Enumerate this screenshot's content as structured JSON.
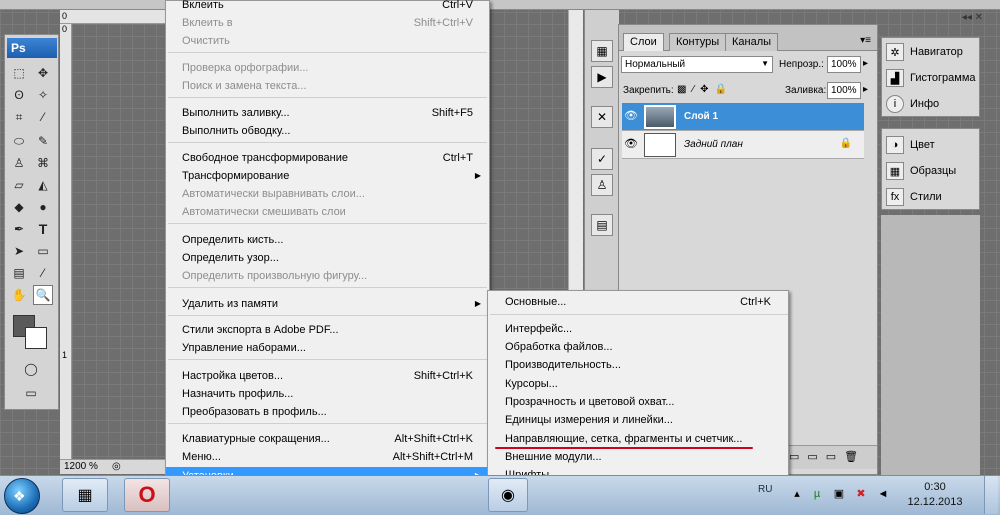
{
  "ruler": {
    "top_num": "0",
    "left_num_top": "0",
    "left_num_mid": "1"
  },
  "status": {
    "zoom": "1200 %"
  },
  "tools": {
    "logo": "Ps"
  },
  "layers_panel": {
    "tabs": [
      "Слои",
      "Контуры",
      "Каналы"
    ],
    "blend_mode": "Нормальный",
    "opacity_label": "Непрозр.:",
    "opacity_value": "100%",
    "lock_label": "Закрепить:",
    "fill_label": "Заливка:",
    "fill_value": "100%",
    "layers": [
      {
        "name": "Слой 1",
        "selected": true
      },
      {
        "name": "Задний план",
        "selected": false
      }
    ]
  },
  "right_panels": {
    "group1": [
      "Навигатор",
      "Гистограмма",
      "Инфо"
    ],
    "group2": [
      "Цвет",
      "Образцы",
      "Стили"
    ]
  },
  "edit_menu": {
    "items": [
      {
        "label": "Вклеить",
        "shortcut": "Ctrl+V",
        "disabled": false
      },
      {
        "label": "Вклеить в",
        "shortcut": "Shift+Ctrl+V",
        "disabled": true
      },
      {
        "label": "Очистить",
        "shortcut": "",
        "disabled": true
      },
      {
        "label": "Проверка орфографии...",
        "shortcut": "",
        "disabled": true
      },
      {
        "label": "Поиск и замена текста...",
        "shortcut": "",
        "disabled": true
      },
      {
        "label": "Выполнить заливку...",
        "shortcut": "Shift+F5",
        "disabled": false
      },
      {
        "label": "Выполнить обводку...",
        "shortcut": "",
        "disabled": false
      },
      {
        "label": "Свободное трансформирование",
        "shortcut": "Ctrl+T",
        "disabled": false
      },
      {
        "label": "Трансформирование",
        "shortcut": "",
        "disabled": false,
        "submenu": true
      },
      {
        "label": "Автоматически выравнивать слои...",
        "shortcut": "",
        "disabled": true
      },
      {
        "label": "Автоматически смешивать слои",
        "shortcut": "",
        "disabled": true
      },
      {
        "label": "Определить кисть...",
        "shortcut": "",
        "disabled": false
      },
      {
        "label": "Определить узор...",
        "shortcut": "",
        "disabled": false
      },
      {
        "label": "Определить произвольную фигуру...",
        "shortcut": "",
        "disabled": true
      },
      {
        "label": "Удалить из памяти",
        "shortcut": "",
        "disabled": false,
        "submenu": true
      },
      {
        "label": "Стили экспорта в Adobe PDF...",
        "shortcut": "",
        "disabled": false
      },
      {
        "label": "Управление наборами...",
        "shortcut": "",
        "disabled": false
      },
      {
        "label": "Настройка цветов...",
        "shortcut": "Shift+Ctrl+K",
        "disabled": false
      },
      {
        "label": "Назначить профиль...",
        "shortcut": "",
        "disabled": false
      },
      {
        "label": "Преобразовать в профиль...",
        "shortcut": "",
        "disabled": false
      },
      {
        "label": "Клавиатурные сокращения...",
        "shortcut": "Alt+Shift+Ctrl+K",
        "disabled": false
      },
      {
        "label": "Меню...",
        "shortcut": "Alt+Shift+Ctrl+M",
        "disabled": false
      },
      {
        "label": "Установки",
        "shortcut": "",
        "disabled": false,
        "submenu": true,
        "highlighted": true
      }
    ]
  },
  "prefs_submenu": {
    "items": [
      {
        "label": "Основные...",
        "shortcut": "Ctrl+K"
      },
      {
        "label": "Интерфейс...",
        "shortcut": ""
      },
      {
        "label": "Обработка файлов...",
        "shortcut": ""
      },
      {
        "label": "Производительность...",
        "shortcut": ""
      },
      {
        "label": "Курсоры...",
        "shortcut": ""
      },
      {
        "label": "Прозрачность и цветовой охват...",
        "shortcut": ""
      },
      {
        "label": "Единицы измерения и линейки...",
        "shortcut": ""
      },
      {
        "label": "Направляющие, сетка, фрагменты и счетчик...",
        "shortcut": ""
      },
      {
        "label": "Внешние модули...",
        "shortcut": ""
      },
      {
        "label": "Шрифты...",
        "shortcut": ""
      }
    ]
  },
  "taskbar": {
    "lang": "RU",
    "time": "0:30",
    "date": "12.12.2013"
  },
  "colors": {
    "menu_highlight": "#3399ff",
    "annotation": "#d0011b",
    "layer_selected": "#3c8fd6"
  }
}
